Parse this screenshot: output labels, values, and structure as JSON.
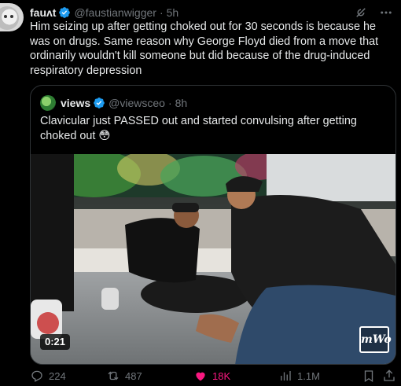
{
  "author": {
    "name": "fauʌt",
    "handle": "@faustianwigger",
    "time": "5h"
  },
  "tweet_text": "Him seizing up after getting choked out for 30 seconds is because he was on drugs. Same reason why George Floyd died from a move that ordinarily wouldn't kill someone but did because of the drug-induced respiratory depression",
  "quoted": {
    "name": "views",
    "handle": "@viewsceo",
    "time": "8h",
    "text": "Clavicular just PASSED out and started convulsing after getting choked out 😳",
    "video": {
      "duration": "0:21",
      "watermark": "mWo"
    }
  },
  "actions": {
    "replies": "224",
    "reposts": "487",
    "likes": "18K",
    "views": "1.1M"
  },
  "colors": {
    "background": "#000000",
    "text": "#e7e9ea",
    "muted": "#71767b",
    "verified": "#1d9bf0",
    "liked": "#f91880",
    "border": "#2f3336"
  }
}
